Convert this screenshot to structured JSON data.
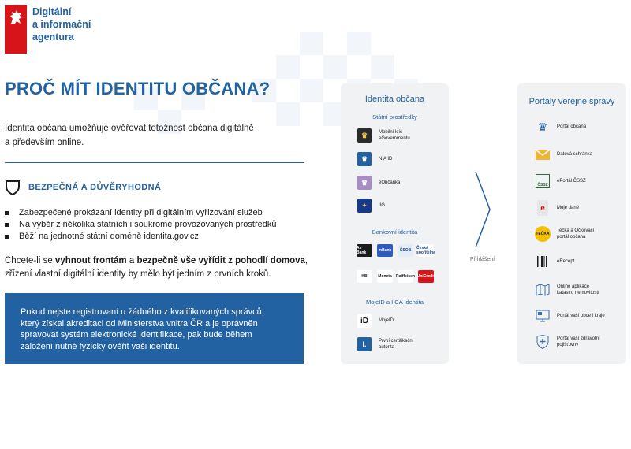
{
  "logo": {
    "line1": "Digitální",
    "line2": "a informační",
    "line3": "agentura",
    "icon": "lion-emblem-icon"
  },
  "main_title": "PROČ MÍT IDENTITU OBČANA?",
  "intro": {
    "line1": "Identita občana umožňuje ověřovat totožnost občana digitálně",
    "line2": "a především online."
  },
  "section": {
    "icon": "shield-icon",
    "title": "BEZPEČNÁ A DŮVĚRYHODNÁ"
  },
  "bullets": [
    "Zabezpečené prokázání identity při digitálním vyřizování služeb",
    "Na výběr z několika státních i soukromě provozovaných prostředků",
    "Běží na jednotné státní doméně identita.gov.cz"
  ],
  "paragraph": {
    "p1": "Chcete-li se ",
    "b1": "vyhnout frontám",
    "p2": " a ",
    "b2": "bezpečně vše vyřídit z pohodlí domova",
    "p3": ",",
    "line2": "zřízení vlastní digitální identity by mělo být jedním z prvních kroků."
  },
  "notice": {
    "line1": "Pokud nejste registrovaní u žádného z kvalifikovaných správců,",
    "line2": "který získal akreditaci od Ministerstva vnitra ČR a je oprávněn",
    "line3": "spravovat systém elektronické identifikace, pak bude během",
    "line4": "založení nutné fyzicky ověřit vaši identitu."
  },
  "identity_card": {
    "title": "Identita občana",
    "state_heading": "Státní prostředky",
    "state_items": [
      {
        "line1": "Mobilní klíč",
        "line2": "eGovernmentu",
        "icon": "mobile-key-icon"
      },
      {
        "line1": "NIA ID",
        "line2": "",
        "icon": "nia-id-icon"
      },
      {
        "line1": "eObčanka",
        "line2": "",
        "icon": "eobcanka-icon"
      },
      {
        "line1": "IIG",
        "line2": "",
        "icon": "eu-flag-icon"
      }
    ],
    "bank_heading": "Bankovní identita",
    "banks_row1": [
      "Air Bank",
      "mBank",
      "ČSOB",
      "Česká spořitelna"
    ],
    "banks_row2": [
      "KB",
      "Moneta",
      "Raiffeisen",
      "UniCredit"
    ],
    "mojeid_heading": "MojeID a I.CA Identita",
    "mojeid_items": [
      {
        "line1": "MojeID",
        "line2": "",
        "icon": "mojeid-icon"
      },
      {
        "line1": "První certifikační",
        "line2": "autorita",
        "icon": "ica-icon"
      }
    ]
  },
  "login_label": "Přihlášení",
  "portals_card": {
    "title": "Portály veřejné správy",
    "items": [
      {
        "line1": "Portál občana",
        "line2": "",
        "icon": "lion-icon"
      },
      {
        "line1": "Datová schránka",
        "line2": "",
        "icon": "envelope-icon"
      },
      {
        "line1": "ePortál ČSSZ",
        "line2": "",
        "icon": "cssz-icon"
      },
      {
        "line1": "Moje daně",
        "line2": "",
        "icon": "tax-icon"
      },
      {
        "line1": "Tečka a Očkovací",
        "line2": "portál občana",
        "icon": "tecka-icon"
      },
      {
        "line1": "eRecept",
        "line2": "",
        "icon": "barcode-icon"
      },
      {
        "line1": "Online aplikace",
        "line2": "katastru nemovitostí",
        "icon": "map-icon"
      },
      {
        "line1": "Portál vaší obce i kraje",
        "line2": "",
        "icon": "monitor-icon"
      },
      {
        "line1": "Portál vaší zdravotní",
        "line2": "pojišťovny",
        "icon": "health-shield-icon"
      }
    ]
  },
  "colors": {
    "brand_blue": "#2362a2",
    "brand_red": "#d7141a",
    "card_bg": "#f1f2f4"
  }
}
